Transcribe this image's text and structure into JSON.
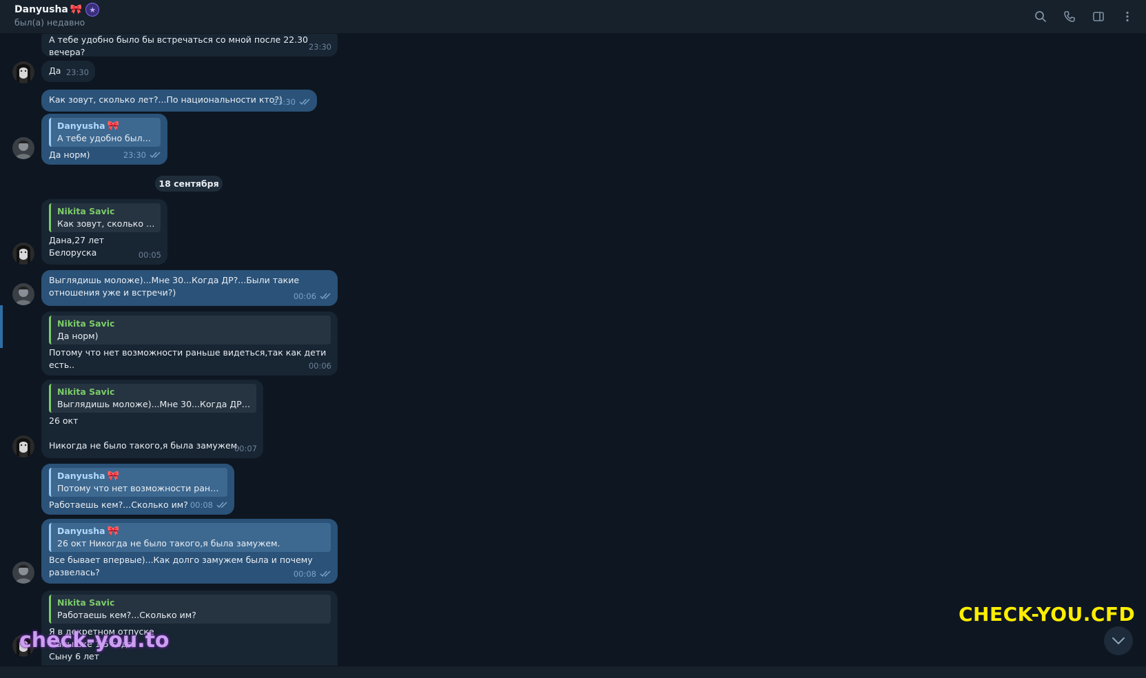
{
  "header": {
    "name": "Danyusha",
    "status": "был(а) недавно",
    "icons": [
      "search-icon",
      "phone-icon",
      "sidebar-icon",
      "more-icon"
    ]
  },
  "date_separator": "18 сентября",
  "messages": [
    {
      "id": "m1",
      "dir": "in",
      "lines": [
        "А тебе удобно было бы встречаться со мной после 22.30 вечера?"
      ],
      "time": "23:30"
    },
    {
      "id": "m2",
      "dir": "in",
      "lines": [
        "Да"
      ],
      "time": "23:30"
    },
    {
      "id": "m3",
      "dir": "out",
      "lines": [
        "Как зовут, сколько лет?...По национальности кто?)"
      ],
      "time": "23:30"
    },
    {
      "id": "m4",
      "dir": "out",
      "reply_name": "Danyusha",
      "reply_text": "А тебе удобно было б...",
      "lines": [
        "Да норм)"
      ],
      "time": "23:30"
    },
    {
      "id": "m5",
      "dir": "in",
      "reply_name": "Nikita Savic",
      "reply_text": "Как зовут, сколько ле...",
      "lines": [
        "Дана,27 лет",
        "Белоруска"
      ],
      "time": "00:05"
    },
    {
      "id": "m6",
      "dir": "out",
      "lines": [
        "Выглядишь моложе)...Мне 30...Когда ДР?...Были такие",
        "отношения уже и встречи?)"
      ],
      "time": "00:06"
    },
    {
      "id": "m7",
      "dir": "in",
      "reply_name": "Nikita Savic",
      "reply_text": "Да норм)",
      "lines": [
        "Потому что нет возможности раньше видеться,так как дети",
        "есть.."
      ],
      "time": "00:06"
    },
    {
      "id": "m8",
      "dir": "in",
      "reply_name": "Nikita Savic",
      "reply_text": "Выглядишь моложе)...Мне 30...Когда ДР?...Б...",
      "lines": [
        "26 окт",
        "",
        "Никогда не было такого,я была замужем."
      ],
      "time": "00:07"
    },
    {
      "id": "m9",
      "dir": "out",
      "reply_name": "Danyusha",
      "reply_text": "Потому что нет возможности раньш...",
      "lines": [
        "Работаешь кем?...Сколько им?"
      ],
      "time": "00:08"
    },
    {
      "id": "m10",
      "dir": "out",
      "reply_name": "Danyusha",
      "reply_text": "26 окт  Никогда не было такого,я была замужем.",
      "lines": [
        "Все бывает впервые)...Как долго замужем была и почему",
        "развелась?"
      ],
      "time": "00:08"
    },
    {
      "id": "m11",
      "dir": "in",
      "reply_name": "Nikita Savic",
      "reply_text": "Работаешь кем?...Сколько им?",
      "lines": [
        "Я в декретном отпуске",
        "Малышке 1,5 года",
        "Сыну 6 лет"
      ],
      "time": ""
    }
  ],
  "watermarks": {
    "yellow": "CHECK-YOU.CFD",
    "purple": "check-you.to"
  },
  "colors": {
    "background": "#0e1621",
    "incoming": "#182533",
    "outgoing": "#2b5278",
    "accent": "#6ab3f3",
    "reply_name_in": "#7ccc6a"
  }
}
